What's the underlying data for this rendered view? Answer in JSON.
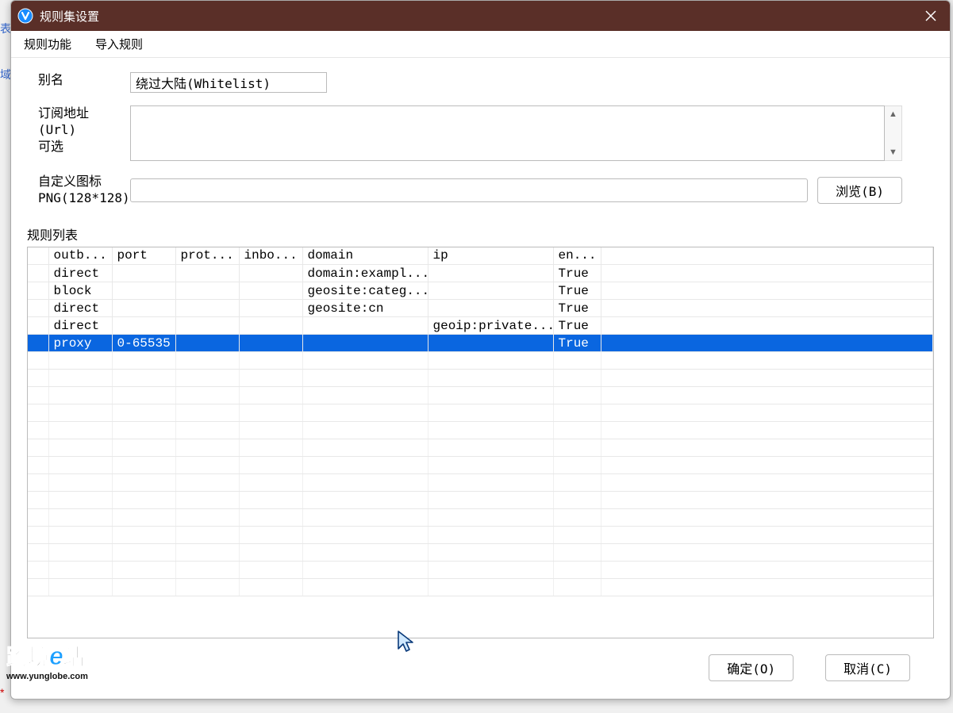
{
  "window": {
    "title": "规则集设置"
  },
  "menubar": {
    "items": [
      "规则功能",
      "导入规则"
    ]
  },
  "form": {
    "alias_label": "别名",
    "alias_value": "绕过大陆(Whitelist)",
    "url_label_1": "订阅地址(Url)",
    "url_label_2": "可选",
    "url_value": "",
    "icon_label_1": "自定义图标",
    "icon_label_2": "PNG(128*128)",
    "icon_value": "",
    "browse_label": "浏览(B)"
  },
  "list": {
    "label": "规则列表",
    "headers": {
      "outb": "outb...",
      "port": "port",
      "prot": "prot...",
      "inbo": "inbo...",
      "domain": "domain",
      "ip": "ip",
      "en": "en..."
    },
    "rows": [
      {
        "outb": "direct",
        "port": "",
        "prot": "",
        "inbo": "",
        "domain": "domain:exampl...",
        "ip": "",
        "en": "True",
        "selected": false
      },
      {
        "outb": "block",
        "port": "",
        "prot": "",
        "inbo": "",
        "domain": "geosite:categ...",
        "ip": "",
        "en": "True",
        "selected": false
      },
      {
        "outb": "direct",
        "port": "",
        "prot": "",
        "inbo": "",
        "domain": "geosite:cn",
        "ip": "",
        "en": "True",
        "selected": false
      },
      {
        "outb": "direct",
        "port": "",
        "prot": "",
        "inbo": "",
        "domain": "",
        "ip": "geoip:private...",
        "en": "True",
        "selected": false
      },
      {
        "outb": "proxy",
        "port": "0-65535",
        "prot": "",
        "inbo": "",
        "domain": "",
        "ip": "",
        "en": "True",
        "selected": true
      }
    ]
  },
  "buttons": {
    "ok": "确定(O)",
    "cancel": "取消(C)"
  },
  "watermark": {
    "line1_a": "跨境",
    "line1_b": "e",
    "line1_c": "站",
    "line2": "www.yunglobe.com"
  }
}
